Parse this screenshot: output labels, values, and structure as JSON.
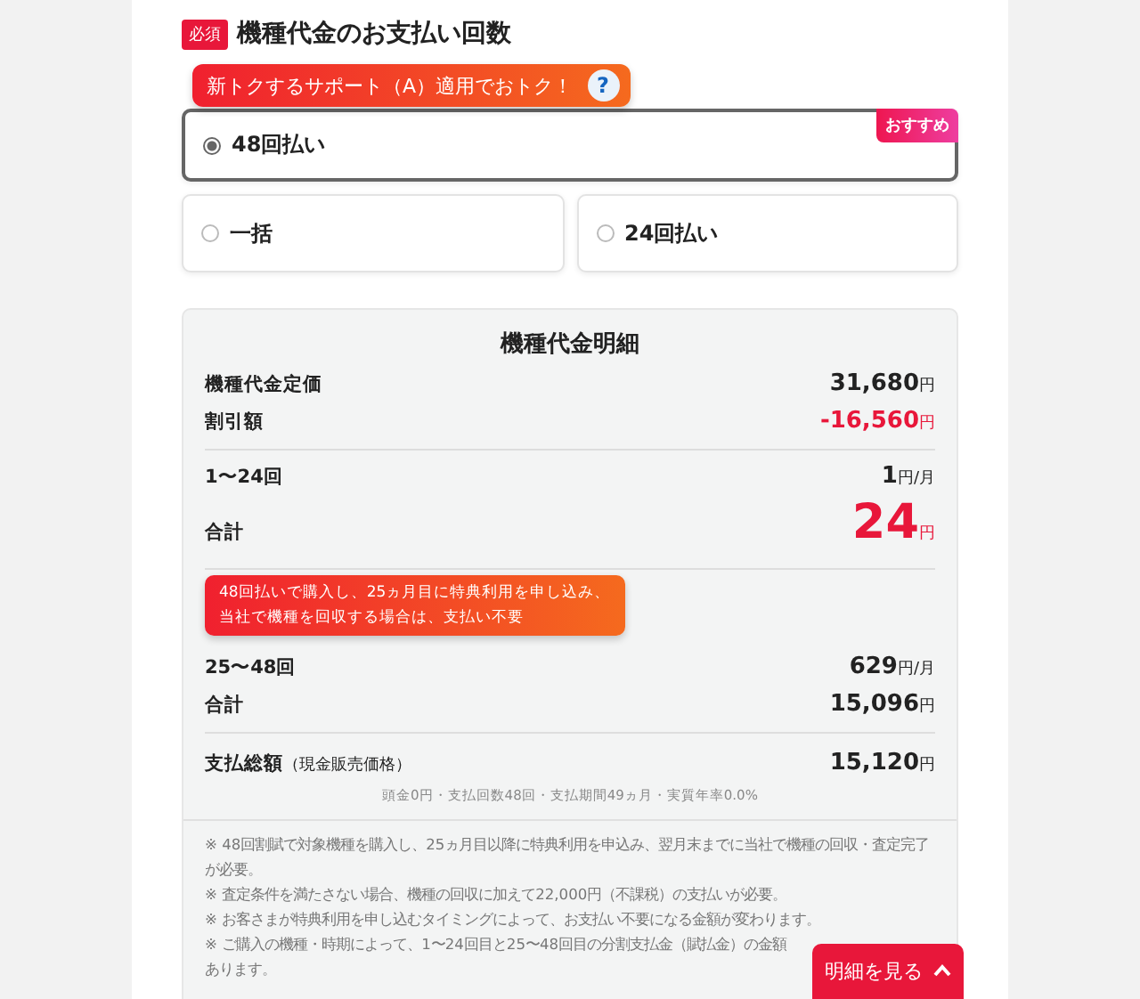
{
  "heading": {
    "badge": "必須",
    "title": "機種代金のお支払い回数"
  },
  "promo_tooltip": {
    "text": "新トクするサポート（A）適用でおトク！",
    "help": "?"
  },
  "payment_options": [
    {
      "label": "48回払い",
      "selected": true,
      "badge": "おすすめ"
    },
    {
      "label": "一括",
      "selected": false
    },
    {
      "label": "24回払い",
      "selected": false
    }
  ],
  "breakdown": {
    "title": "機種代金明細",
    "groups": [
      [
        {
          "label": "機種代金定価",
          "amount": "31,680",
          "unit": "円",
          "kind": "normal"
        },
        {
          "label": "割引額",
          "amount": "-16,560",
          "unit": "円",
          "kind": "discount"
        }
      ],
      [
        {
          "label": "1〜24回",
          "amount": "1",
          "unit": "円/月",
          "kind": "normal"
        },
        {
          "label": "合計",
          "amount": "24",
          "unit": "円",
          "kind": "big"
        }
      ],
      [
        {
          "label": "25〜48回",
          "amount": "629",
          "unit": "円/月",
          "kind": "normal"
        },
        {
          "label": "合計",
          "amount": "15,096",
          "unit": "円",
          "kind": "normal"
        }
      ]
    ],
    "tooltip": [
      "48回払いで購入し、25ヵ月目に特典利用を申し込み、",
      "当社で機種を回収する場合は、支払い不要"
    ],
    "total": {
      "label": "支払総額",
      "sub": "（現金販売価格）",
      "amount": "15,120",
      "unit": "円"
    },
    "terms": "頭金0円・支払回数48回・支払期間49ヵ月・実質年率0.0%",
    "notes": [
      "※ 48回割賦で対象機種を購入し、25ヵ月目以降に特典利用を申込み、翌月末までに当社で機種の回収・査定完了が必要。",
      "※ 査定条件を満たさない場合、機種の回収に加えて22,000円（不課税）の支払いが必要。",
      "※ お客さまが特典利用を申し込むタイミングによって、お支払い不要になる金額が変わります。",
      "※ ご購入の機種・時期によって、1〜24回目と25〜48回目の分割支払金（賦払金）の金額",
      "あります。"
    ]
  },
  "detail_button": {
    "label": "明細を見る"
  }
}
